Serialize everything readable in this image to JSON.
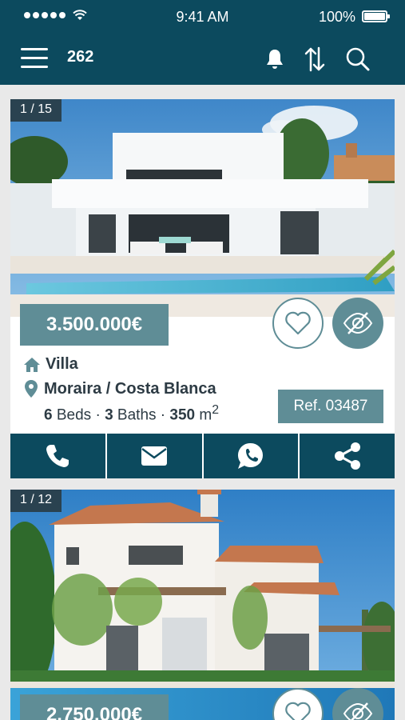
{
  "status_bar": {
    "time": "9:41 AM",
    "battery": "100%"
  },
  "navbar": {
    "count": "262"
  },
  "listings": [
    {
      "photo_counter": "1 / 15",
      "price": "3.500.000€",
      "type": "Villa",
      "location": "Moraira / Costa Blanca",
      "beds": "6",
      "beds_label": "Beds",
      "baths": "3",
      "baths_label": "Baths",
      "area": "350",
      "area_unit": "m",
      "area_sup": "2",
      "ref": "Ref. 03487"
    },
    {
      "photo_counter": "1 / 12",
      "price": "2.750.000€"
    }
  ],
  "colors": {
    "primary": "#0c4a5e",
    "accent": "#5f8d96",
    "text": "#2d3b44",
    "background": "#e9e9e9"
  }
}
